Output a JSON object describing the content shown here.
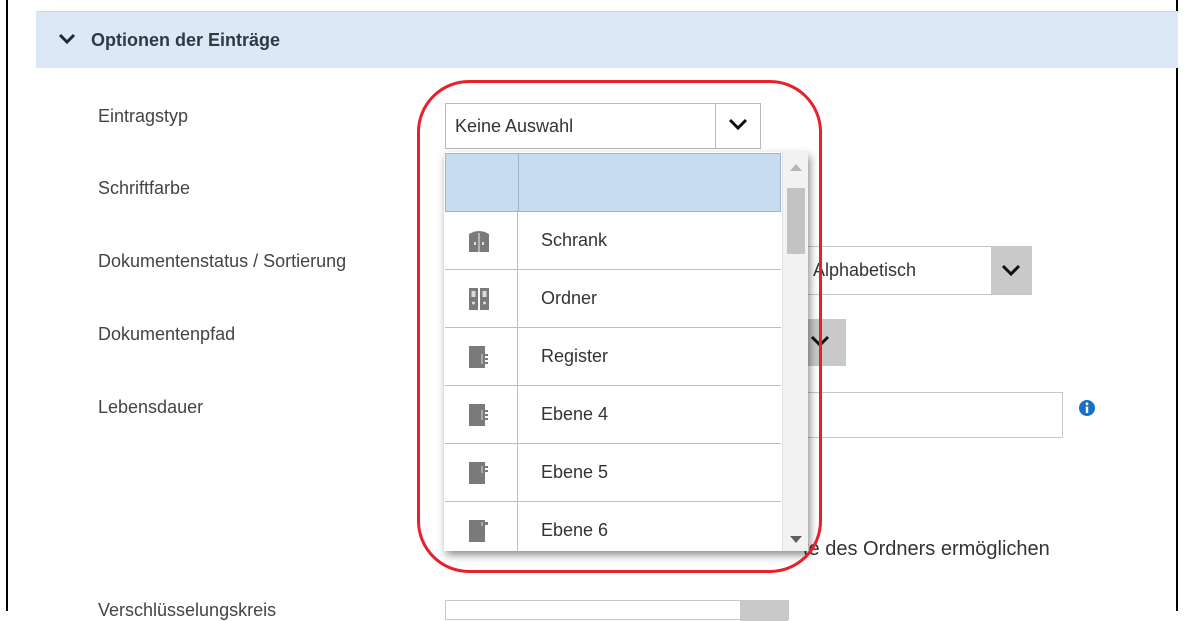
{
  "section": {
    "title": "Optionen der Einträge",
    "icon": "chevron-down-icon"
  },
  "labels": {
    "eintragstyp": "Eintragstyp",
    "schriftfarbe": "Schriftfarbe",
    "dokumentenstatus": "Dokumentenstatus / Sortierung",
    "dokumentenpfad": "Dokumentenpfad",
    "lebensdauer": "Lebensdauer",
    "verschluesselung": "Verschlüsselungskreis"
  },
  "eintragstyp_select": {
    "value": "Keine Auswahl"
  },
  "sortierung_select": {
    "value": "Alphabetisch"
  },
  "checkbox_text": "te des Ordners ermöglichen",
  "dropdown": {
    "options": [
      {
        "label": "Schrank",
        "icon": "cabinet-icon"
      },
      {
        "label": "Ordner",
        "icon": "binder-icon"
      },
      {
        "label": "Register",
        "icon": "register-icon"
      },
      {
        "label": "Ebene 4",
        "icon": "level-4-icon"
      },
      {
        "label": "Ebene 5",
        "icon": "level-5-icon"
      },
      {
        "label": "Ebene 6",
        "icon": "level-6-icon"
      }
    ]
  },
  "colors": {
    "header_bg": "#dce8f5",
    "highlight_bg": "#c7dcf0",
    "outline": "#e8202a",
    "info": "#1a6fc4"
  }
}
